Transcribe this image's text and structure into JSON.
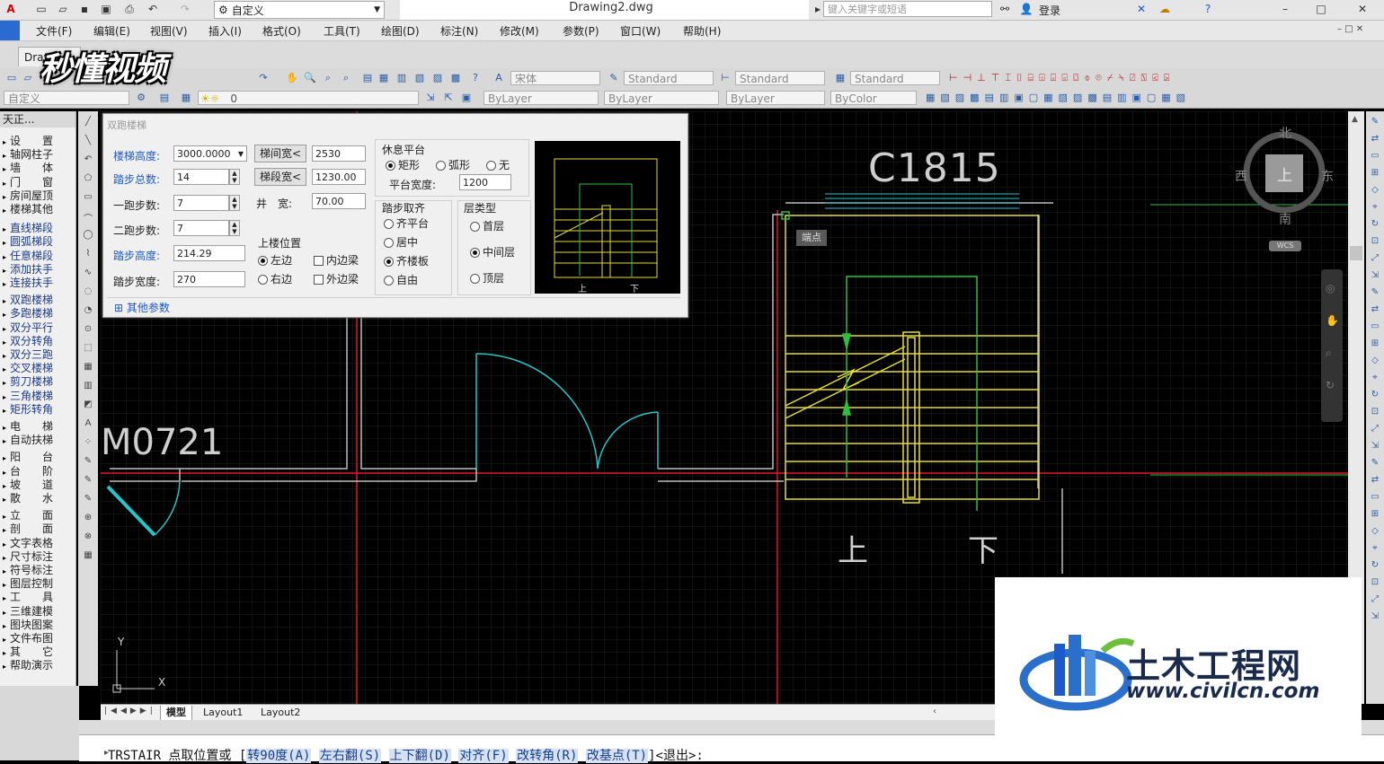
{
  "titlebar": {
    "workspace": "自定义",
    "document": "Drawing2.dwg",
    "search_placeholder": "键入关键字或短语",
    "login": "登录"
  },
  "menu": [
    "文件(F)",
    "编辑(E)",
    "视图(V)",
    "插入(I)",
    "格式(O)",
    "工具(T)",
    "绘图(D)",
    "标注(N)",
    "修改(M)",
    "参数(P)",
    "窗口(W)",
    "帮助(H)"
  ],
  "doc_tab": "Draw",
  "toolbar": {
    "font": "宋体",
    "text_style": "Standard",
    "dim_style": "Standard",
    "table_style": "Standard",
    "custom": "自定义",
    "layer": "0",
    "color": "ByLayer",
    "linetype": "ByLayer",
    "lineweight": "ByLayer",
    "plotstyle": "ByColor"
  },
  "left_panel": {
    "title": "天正...",
    "items": [
      "设　　置",
      "轴网柱子",
      "墙　　体",
      "门　　窗",
      "房间屋顶",
      "楼梯其他",
      "直线梯段",
      "圆弧梯段",
      "任意梯段",
      "添加扶手",
      "连接扶手",
      "双跑楼梯",
      "多跑楼梯",
      "双分平行",
      "双分转角",
      "双分三跑",
      "交叉楼梯",
      "剪刀楼梯",
      "三角楼梯",
      "矩形转角",
      "电　　梯",
      "自动扶梯",
      "阳　　台",
      "台　　阶",
      "坡　　道",
      "散　　水",
      "立　　面",
      "剖　　面",
      "文字表格",
      "尺寸标注",
      "符号标注",
      "图层控制",
      "工　　具",
      "三维建模",
      "图块图案",
      "文件布图",
      "其　　它",
      "帮助演示"
    ]
  },
  "dialog": {
    "title": "双跑楼梯",
    "stair_height_label": "楼梯高度:",
    "stair_height_value": "3000.0000",
    "total_steps_label": "踏步总数:",
    "total_steps_value": "14",
    "run1_label": "一跑步数:",
    "run1_value": "7",
    "run2_label": "二跑步数:",
    "run2_value": "7",
    "step_height_label": "踏步高度:",
    "step_height_value": "214.29",
    "step_width_label": "踏步宽度:",
    "step_width_value": "270",
    "btn_stair_width": "梯间宽<",
    "stair_width_value": "2530",
    "btn_flight_width": "梯段宽<",
    "flight_width_value": "1230.00",
    "well_label": "井　宽:",
    "well_value": "70.00",
    "up_position_label": "上楼位置",
    "up_left": "左边",
    "up_right": "右边",
    "inner_beam": "内边梁",
    "outer_beam": "外边梁",
    "landing_label": "休息平台",
    "landing_rect": "矩形",
    "landing_arc": "弧形",
    "landing_none": "无",
    "landing_width_label": "平台宽度:",
    "landing_width_value": "1200",
    "align_label": "踏步取齐",
    "align_platform": "齐平台",
    "align_center": "居中",
    "align_slab": "齐楼板",
    "align_free": "自由",
    "floor_type_label": "层类型",
    "floor_first": "首层",
    "floor_middle": "中间层",
    "floor_top": "顶层",
    "more_params": "其他参数",
    "preview_up": "上",
    "preview_down": "下"
  },
  "canvas": {
    "label_window": "C1815",
    "label_door": "M0721",
    "tooltip": "端点",
    "up": "上",
    "down": "下",
    "axis_y": "Y",
    "axis_x": "X"
  },
  "compass": {
    "north": "北",
    "south": "南",
    "east": "东",
    "west": "西",
    "top": "上",
    "wcs": "WCS"
  },
  "tabs": [
    "模型",
    "Layout1",
    "Layout2"
  ],
  "command": {
    "prefix": "TRSTAIR 点取位置或 [",
    "options": [
      "转90度(A)",
      "左右翻(S)",
      "上下翻(D)",
      "对齐(F)",
      "改转角(R)",
      "改基点(T)"
    ],
    "suffix": "]<退出>:"
  },
  "watermark": {
    "top_left": "秒懂视频",
    "brand_cn": "土木工程网",
    "brand_url": "www.civilcn.com"
  },
  "colors": {
    "axis_red": "#e0192a",
    "wall": "#bdbdbd",
    "stair_yellow": "#e6dc3a",
    "stair_green": "#2fc03c",
    "door_cyan": "#28c4c8",
    "highlight_blue": "#1d59c8"
  }
}
